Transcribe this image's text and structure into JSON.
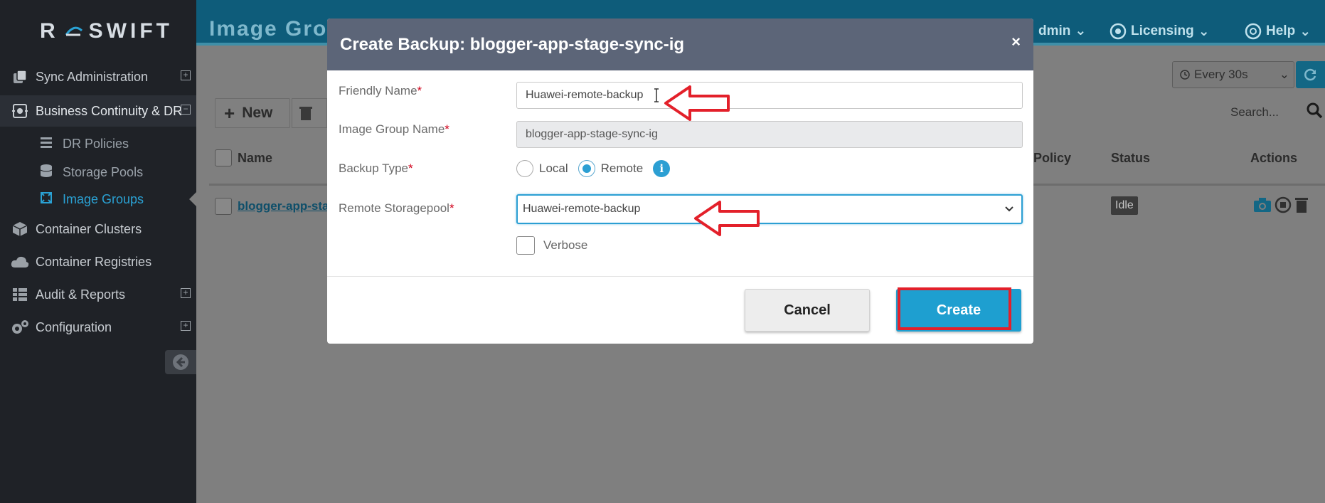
{
  "app": {
    "brand_left": "R",
    "brand_right": "SWIFT"
  },
  "sidebar": {
    "items": [
      {
        "label": "Sync Administration",
        "icon": "copy-icon",
        "expandable": true
      },
      {
        "label": "Business Continuity & DR",
        "icon": "dr-icon",
        "expandable": true,
        "active": true
      },
      {
        "label": "Container Clusters",
        "icon": "cube-icon",
        "expandable": false
      },
      {
        "label": "Container Registries",
        "icon": "cloud-icon",
        "expandable": false
      },
      {
        "label": "Audit & Reports",
        "icon": "table-icon",
        "expandable": true
      },
      {
        "label": "Configuration",
        "icon": "gears-icon",
        "expandable": true
      }
    ],
    "sub_items": [
      {
        "label": "DR Policies",
        "icon": "list-icon"
      },
      {
        "label": "Storage Pools",
        "icon": "database-icon"
      },
      {
        "label": "Image Groups",
        "icon": "image-group-icon",
        "selected": true
      }
    ]
  },
  "header": {
    "page_title": "Image Grou",
    "menus": [
      {
        "label": "dmin",
        "icon": "user-icon"
      },
      {
        "label": "Licensing",
        "icon": "licensing-icon"
      },
      {
        "label": "Help",
        "icon": "help-icon"
      }
    ]
  },
  "toolbar": {
    "new_label": "New",
    "refresh_interval": "Every 30s",
    "search_placeholder": "Search..."
  },
  "table": {
    "columns": {
      "name": "Name",
      "policy": "Policy",
      "status": "Status",
      "actions": "Actions"
    },
    "rows": [
      {
        "name": "blogger-app-sta",
        "status": "Idle"
      }
    ]
  },
  "modal": {
    "title": "Create Backup: blogger-app-stage-sync-ig",
    "close": "×",
    "fields": {
      "friendly_name": {
        "label": "Friendly Name",
        "required": "*",
        "value": "Huawei-remote-backup"
      },
      "image_group_name": {
        "label": "Image Group Name",
        "required": "*",
        "value": "blogger-app-stage-sync-ig"
      },
      "backup_type": {
        "label": "Backup Type",
        "required": "*",
        "options": [
          "Local",
          "Remote"
        ],
        "selected": "Remote",
        "info": "i"
      },
      "remote_storagepool": {
        "label": "Remote Storagepool",
        "required": "*",
        "value": "Huawei-remote-backup"
      },
      "verbose": {
        "label": "Verbose",
        "checked": false
      }
    },
    "buttons": {
      "cancel": "Cancel",
      "create": "Create"
    }
  },
  "colors": {
    "sidebar_bg": "#1f2227",
    "accent": "#2c9fd3",
    "modal_header": "#5c6578",
    "annotation_red": "#e3202a"
  }
}
